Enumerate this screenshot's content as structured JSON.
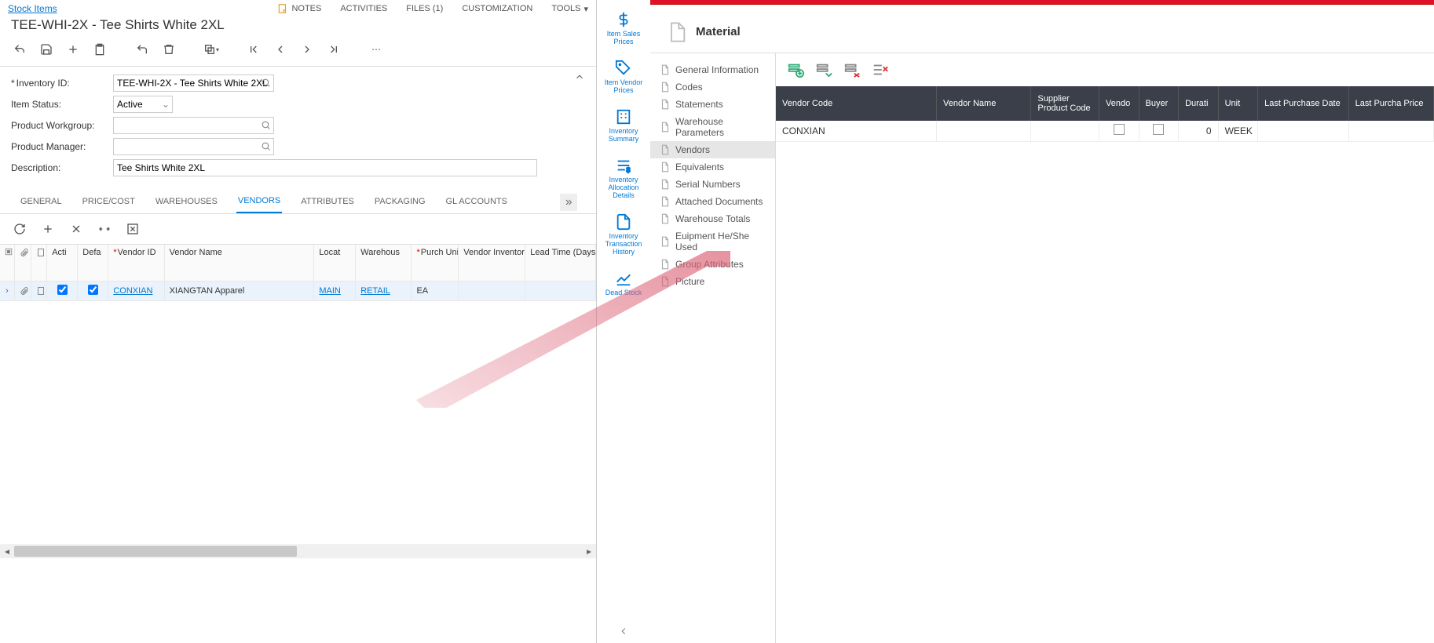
{
  "left": {
    "breadcrumb": "Stock Items",
    "title": "TEE-WHI-2X - Tee Shirts White 2XL",
    "menu": {
      "notes": "NOTES",
      "activities": "ACTIVITIES",
      "files": "FILES (1)",
      "customization": "CUSTOMIZATION",
      "tools": "TOOLS"
    },
    "form": {
      "inventory_id_label": "Inventory ID:",
      "inventory_id_value": "TEE-WHI-2X - Tee Shirts White 2XL",
      "item_status_label": "Item Status:",
      "item_status_value": "Active",
      "workgroup_label": "Product Workgroup:",
      "workgroup_value": "",
      "manager_label": "Product Manager:",
      "manager_value": "",
      "description_label": "Description:",
      "description_value": "Tee Shirts White 2XL"
    },
    "tabs": [
      "GENERAL",
      "PRICE/COST",
      "WAREHOUSES",
      "VENDORS",
      "ATTRIBUTES",
      "PACKAGING",
      "GL ACCOUNTS"
    ],
    "active_tab": 3,
    "grid_headers": {
      "act": "Acti",
      "def": "Defa",
      "vendor_id": "Vendor ID",
      "vendor_name": "Vendor Name",
      "locat": "Locat",
      "warehous": "Warehous",
      "purch_unit": "Purch Unit",
      "vendor_inv_id": "Vendor Inventory ID",
      "lead_time": "Lead Time (Days)"
    },
    "grid_row": {
      "vendor_id": "CONXIAN",
      "vendor_name": "XIANGTAN Apparel",
      "location": "MAIN",
      "warehouse": "RETAIL",
      "purch_unit": "EA"
    }
  },
  "sidenav": [
    {
      "label": "Item Sales Prices"
    },
    {
      "label": "Item Vendor Prices"
    },
    {
      "label": "Inventory Summary"
    },
    {
      "label": "Inventory Allocation Details"
    },
    {
      "label": "Inventory Transaction History"
    },
    {
      "label": "Dead Stock"
    }
  ],
  "right": {
    "title": "Material",
    "sidebar": [
      "General Information",
      "Codes",
      "Statements",
      "Warehouse Parameters",
      "Vendors",
      "Equivalents",
      "Serial Numbers",
      "Attached Documents",
      "Warehouse Totals",
      "Euipment He/She Used",
      "Group Attributes",
      "Picture"
    ],
    "active_sidebar": 4,
    "headers": [
      "Vendor Code",
      "Vendor Name",
      "Supplier Product Code",
      "Vendo",
      "Buyer",
      "Durati",
      "Unit",
      "Last Purchase Date",
      "Last Purcha Price"
    ],
    "row": {
      "vendor_code": "CONXIAN",
      "duration": "0",
      "unit": "WEEK"
    }
  }
}
